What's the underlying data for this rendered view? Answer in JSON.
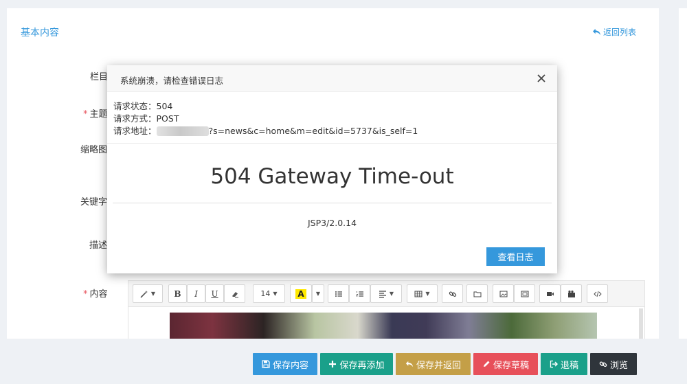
{
  "panel": {
    "title": "基本内容",
    "back_label": "返回列表"
  },
  "form": {
    "labels": [
      {
        "text": "栏目",
        "required": false
      },
      {
        "text": "主题",
        "required": true
      },
      {
        "text": "缩略图",
        "required": false
      },
      {
        "text": "关键字",
        "required": false
      },
      {
        "text": "描述",
        "required": false
      },
      {
        "text": "内容",
        "required": true
      }
    ],
    "required_mark": "*"
  },
  "editor": {
    "font_size": "14",
    "highlight_letter": "A",
    "bold": "B",
    "italic": "I",
    "underline": "U"
  },
  "actions": {
    "save": "保存内容",
    "save_add": "保存再添加",
    "save_return": "保存并返回",
    "save_draft": "保存草稿",
    "logout": "退稿",
    "preview": "浏览"
  },
  "colors": {
    "primary": "#3598dc",
    "teal": "#1aa08a",
    "gold": "#c49f47",
    "red": "#e7505a",
    "dark": "#2f353b"
  },
  "modal": {
    "title": "系统崩溃，请检查错误日志",
    "status_label": "请求状态：",
    "status_value": "504",
    "method_label": "请求方式：",
    "method_value": "POST",
    "url_label": "请求地址：",
    "url_value": "?s=news&c=home&m=edit&id=5737&is_self=1",
    "error_title": "504 Gateway Time-out",
    "server": "JSP3/2.0.14",
    "log_button": "查看日志"
  }
}
